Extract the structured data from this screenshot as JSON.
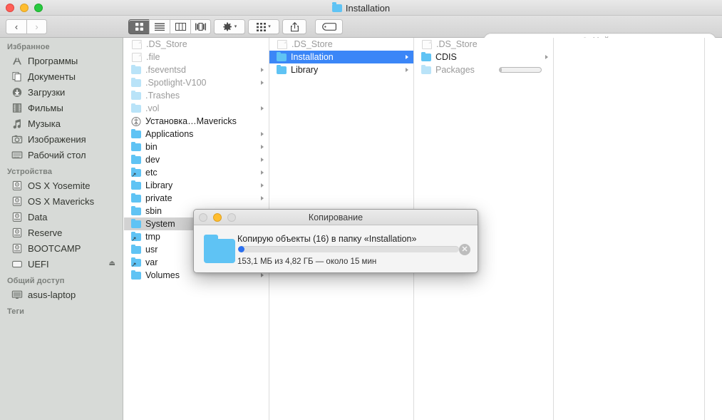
{
  "window": {
    "title": "Installation",
    "title_icon": "folder-icon",
    "traffic_lights": [
      "close-button",
      "minimize-button",
      "zoom-button"
    ]
  },
  "toolbar": {
    "back_label": "‹",
    "forward_label": "›",
    "view_buttons": [
      {
        "name": "icon-view",
        "icon": "grid-icon",
        "active": true
      },
      {
        "name": "list-view",
        "icon": "list-icon",
        "active": false
      },
      {
        "name": "column-view",
        "icon": "columns-icon",
        "active": false
      },
      {
        "name": "coverflow-view",
        "icon": "coverflow-icon",
        "active": false
      }
    ],
    "action_label": "gear-icon",
    "arrange_label": "arrange-icon",
    "share_label": "share-icon",
    "tag_label": "tag-icon",
    "chevron": "▾"
  },
  "search": {
    "placeholder": "Найти",
    "icon": "search-icon",
    "value": ""
  },
  "sidebar": {
    "sections": [
      {
        "header": "Избранное",
        "items": [
          {
            "label": "Программы",
            "icon": "applications-icon"
          },
          {
            "label": "Документы",
            "icon": "documents-icon"
          },
          {
            "label": "Загрузки",
            "icon": "downloads-icon"
          },
          {
            "label": "Фильмы",
            "icon": "movies-icon"
          },
          {
            "label": "Музыка",
            "icon": "music-icon"
          },
          {
            "label": "Изображения",
            "icon": "pictures-icon"
          },
          {
            "label": "Рабочий стол",
            "icon": "desktop-icon"
          }
        ]
      },
      {
        "header": "Устройства",
        "items": [
          {
            "label": "OS X Yosemite",
            "icon": "harddisk-icon"
          },
          {
            "label": "OS X Mavericks",
            "icon": "harddisk-icon"
          },
          {
            "label": "Data",
            "icon": "harddisk-icon"
          },
          {
            "label": "Reserve",
            "icon": "harddisk-icon"
          },
          {
            "label": "BOOTCAMP",
            "icon": "harddisk-icon"
          },
          {
            "label": "UEFI",
            "icon": "removable-disk-icon",
            "eject": "⏏"
          }
        ]
      },
      {
        "header": "Общий доступ",
        "items": [
          {
            "label": "asus-laptop",
            "icon": "computer-icon"
          }
        ]
      },
      {
        "header": "Теги",
        "items": []
      }
    ]
  },
  "columns": [
    {
      "name": "column-root",
      "rows": [
        {
          "label": ".DS_Store",
          "icon": "file-icon",
          "dim": true,
          "disclosure": false
        },
        {
          "label": ".file",
          "icon": "file-icon",
          "dim": true,
          "disclosure": false
        },
        {
          "label": ".fseventsd",
          "icon": "folder-pale-icon",
          "dim": true,
          "disclosure": true
        },
        {
          "label": ".Spotlight-V100",
          "icon": "folder-pale-icon",
          "dim": true,
          "disclosure": true
        },
        {
          "label": ".Trashes",
          "icon": "folder-pale-icon",
          "dim": true,
          "disclosure": false
        },
        {
          "label": ".vol",
          "icon": "folder-pale-icon",
          "dim": true,
          "disclosure": true
        },
        {
          "label": "Установка…Mavericks",
          "icon": "app-icon",
          "dim": false,
          "disclosure": false
        },
        {
          "label": "Applications",
          "icon": "folder-icon",
          "dim": false,
          "disclosure": true
        },
        {
          "label": "bin",
          "icon": "folder-icon",
          "dim": false,
          "disclosure": true
        },
        {
          "label": "dev",
          "icon": "folder-icon",
          "dim": false,
          "disclosure": true
        },
        {
          "label": "etc",
          "icon": "folder-alias-icon",
          "dim": false,
          "disclosure": true
        },
        {
          "label": "Library",
          "icon": "folder-icon",
          "dim": false,
          "disclosure": true
        },
        {
          "label": "private",
          "icon": "folder-icon",
          "dim": false,
          "disclosure": true
        },
        {
          "label": "sbin",
          "icon": "folder-icon",
          "dim": false,
          "disclosure": true
        },
        {
          "label": "System",
          "icon": "folder-icon",
          "dim": false,
          "disclosure": true,
          "selected": "gray"
        },
        {
          "label": "tmp",
          "icon": "folder-alias-icon",
          "dim": false,
          "disclosure": false
        },
        {
          "label": "usr",
          "icon": "folder-icon",
          "dim": false,
          "disclosure": true
        },
        {
          "label": "var",
          "icon": "folder-alias-icon",
          "dim": false,
          "disclosure": false
        },
        {
          "label": "Volumes",
          "icon": "folder-icon",
          "dim": false,
          "disclosure": true
        }
      ]
    },
    {
      "name": "column-system",
      "rows": [
        {
          "label": ".DS_Store",
          "icon": "file-icon",
          "dim": true,
          "disclosure": false
        },
        {
          "label": "Installation",
          "icon": "folder-icon",
          "dim": false,
          "disclosure": true,
          "selected": "blue"
        },
        {
          "label": "Library",
          "icon": "folder-icon",
          "dim": false,
          "disclosure": true
        }
      ]
    },
    {
      "name": "column-installation",
      "rows": [
        {
          "label": ".DS_Store",
          "icon": "file-icon",
          "dim": true,
          "disclosure": false
        },
        {
          "label": "CDIS",
          "icon": "folder-icon",
          "dim": false,
          "disclosure": true
        },
        {
          "label": "Packages",
          "icon": "folder-pale-icon",
          "dim": true,
          "disclosure": false,
          "progress": 6
        }
      ]
    },
    {
      "name": "column-preview",
      "rows": []
    },
    {
      "name": "column-extra",
      "rows": []
    }
  ],
  "copy_dialog": {
    "title": "Копирование",
    "message": "Копирую объекты (16) в папку «Installation»",
    "status": "153,1 МБ из 4,82 ГБ — около 15 мин",
    "progress_percent": 3,
    "cancel_label": "✕",
    "folder_icon": "folder-icon",
    "traffic_lights": [
      "close-button-disabled",
      "minimize-button",
      "zoom-button-disabled"
    ]
  },
  "colors": {
    "selection_blue": "#3b86f7",
    "progress_blue": "#2a6ff0",
    "folder_blue": "#5fc3f4",
    "sidebar_bg": "#d7dad7"
  }
}
